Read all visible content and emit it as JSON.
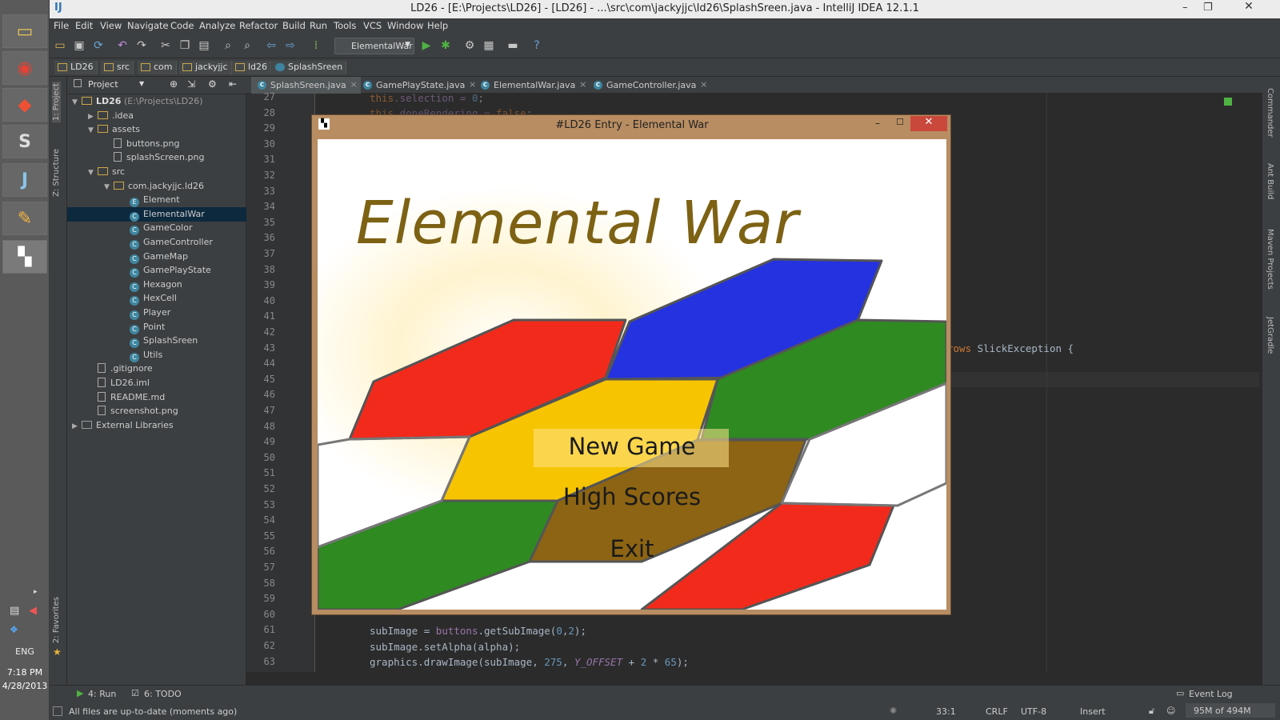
{
  "taskbar": {
    "time": "7:18 PM",
    "date": "4/28/2013",
    "lang": "ENG"
  },
  "window": {
    "title": "LD26 - [E:\\Projects\\LD26] - [LD26] - ...\\src\\com\\jackyjjc\\ld26\\SplashSreen.java - IntelliJ IDEA 12.1.1"
  },
  "menu": [
    "File",
    "Edit",
    "View",
    "Navigate",
    "Code",
    "Analyze",
    "Refactor",
    "Build",
    "Run",
    "Tools",
    "VCS",
    "Window",
    "Help"
  ],
  "toolbar": {
    "run_config": "ElementalWar"
  },
  "breadcrumbs": [
    "LD26",
    "src",
    "com",
    "jackyjjc",
    "ld26",
    "SplashSreen"
  ],
  "left_strip": {
    "project": "1: Project",
    "structure": "Z: Structure",
    "favorites": "2: Favorites"
  },
  "right_strip": {
    "commander": "Commander",
    "ant": "Ant Build",
    "maven": "Maven Projects",
    "gradle": "JetGradle"
  },
  "project_panel": {
    "header": "Project",
    "tree": [
      {
        "label": "LD26",
        "extra": " (E:\\Projects\\LD26)",
        "icon": "folder",
        "depth": 0,
        "arrow": "open"
      },
      {
        "label": ".idea",
        "extra": "",
        "icon": "folder",
        "depth": 1,
        "arrow": "closed"
      },
      {
        "label": "assets",
        "extra": "",
        "icon": "folder",
        "depth": 1,
        "arrow": "open"
      },
      {
        "label": "buttons.png",
        "extra": "",
        "icon": "file",
        "depth": 2,
        "arrow": "none"
      },
      {
        "label": "splashScreen.png",
        "extra": "",
        "icon": "file",
        "depth": 2,
        "arrow": "none"
      },
      {
        "label": "src",
        "extra": "",
        "icon": "folder",
        "depth": 1,
        "arrow": "open"
      },
      {
        "label": "com.jackyjjc.ld26",
        "extra": "",
        "icon": "folder",
        "depth": 2,
        "arrow": "open"
      },
      {
        "label": "Element",
        "extra": "",
        "icon": "enum",
        "depth": 3,
        "arrow": "none"
      },
      {
        "label": "ElementalWar",
        "extra": "",
        "icon": "class",
        "depth": 3,
        "arrow": "none",
        "selected": true
      },
      {
        "label": "GameColor",
        "extra": "",
        "icon": "class",
        "depth": 3,
        "arrow": "none"
      },
      {
        "label": "GameController",
        "extra": "",
        "icon": "class",
        "depth": 3,
        "arrow": "none"
      },
      {
        "label": "GameMap",
        "extra": "",
        "icon": "class",
        "depth": 3,
        "arrow": "none"
      },
      {
        "label": "GamePlayState",
        "extra": "",
        "icon": "class",
        "depth": 3,
        "arrow": "none"
      },
      {
        "label": "Hexagon",
        "extra": "",
        "icon": "class",
        "depth": 3,
        "arrow": "none"
      },
      {
        "label": "HexCell",
        "extra": "",
        "icon": "class",
        "depth": 3,
        "arrow": "none"
      },
      {
        "label": "Player",
        "extra": "",
        "icon": "class",
        "depth": 3,
        "arrow": "none"
      },
      {
        "label": "Point",
        "extra": "",
        "icon": "class",
        "depth": 3,
        "arrow": "none"
      },
      {
        "label": "SplashSreen",
        "extra": "",
        "icon": "class",
        "depth": 3,
        "arrow": "none"
      },
      {
        "label": "Utils",
        "extra": "",
        "icon": "class",
        "depth": 3,
        "arrow": "none"
      },
      {
        "label": ".gitignore",
        "extra": "",
        "icon": "file",
        "depth": 1,
        "arrow": "none"
      },
      {
        "label": "LD26.iml",
        "extra": "",
        "icon": "file",
        "depth": 1,
        "arrow": "none"
      },
      {
        "label": "README.md",
        "extra": "",
        "icon": "file",
        "depth": 1,
        "arrow": "none"
      },
      {
        "label": "screenshot.png",
        "extra": "",
        "icon": "file",
        "depth": 1,
        "arrow": "none"
      },
      {
        "label": "External Libraries",
        "extra": "",
        "icon": "lib",
        "depth": 0,
        "arrow": "closed"
      }
    ]
  },
  "tabs": [
    {
      "label": "SplashSreen.java",
      "active": true
    },
    {
      "label": "GamePlayState.java",
      "active": false
    },
    {
      "label": "ElementalWar.java",
      "active": false
    },
    {
      "label": "GameController.java",
      "active": false
    }
  ],
  "editor": {
    "line_numbers": [
      "27",
      "28",
      "29",
      "30",
      "31",
      "32",
      "33",
      "34",
      "35",
      "36",
      "37",
      "38",
      "39",
      "40",
      "41",
      "42",
      "43",
      "44",
      "45",
      "46",
      "47",
      "48",
      "49",
      "50",
      "51",
      "52",
      "53",
      "54",
      "55",
      "56",
      "57",
      "58",
      "59",
      "60",
      "61",
      "62",
      "63"
    ],
    "visible_code": {
      "l27_kw": "this",
      "l27_rest": ".selection = ",
      "l27_num": "0",
      "l27_end": ";",
      "l28_kw": "this",
      "l28_rest": ".doneRendering = ",
      "l28_kw2": "false",
      "l28_end": ";",
      "l43_kw": "rows",
      "l43_rest": " SlickException {",
      "l61_a": "subImage = ",
      "l61_f": "buttons",
      "l61_b": ".getSubImage(",
      "l61_n1": "0",
      "l61_c": ",",
      "l61_n2": "2",
      "l61_d": ");",
      "l62": "subImage.setAlpha(alpha);",
      "l63_a": "graphics.drawImage(subImage, ",
      "l63_n": "275",
      "l63_b": ", ",
      "l63_i": "Y_OFFSET",
      "l63_c": " + ",
      "l63_n2": "2",
      "l63_d": " * ",
      "l63_n3": "65",
      "l63_e": ");"
    }
  },
  "game_window": {
    "title": "#LD26 Entry - Elemental War",
    "game_title": "Elemental War",
    "menu": {
      "new_game": "New Game",
      "high_scores": "High Scores",
      "exit": "Exit"
    },
    "colors": {
      "red": "#f22a1c",
      "blue": "#2432e0",
      "green": "#2f8a22",
      "yellow": "#f6c400",
      "brown": "#8d6413",
      "title_gold": "#7d6214"
    }
  },
  "statusbar": {
    "run": "4: Run",
    "todo": "6: TODO",
    "event_log": "Event Log",
    "message": "All files are up-to-date (moments ago)",
    "position": "33:1",
    "line_sep": "CRLF",
    "encoding": "UTF-8",
    "mode": "Insert",
    "memory": "95M of 494M"
  }
}
